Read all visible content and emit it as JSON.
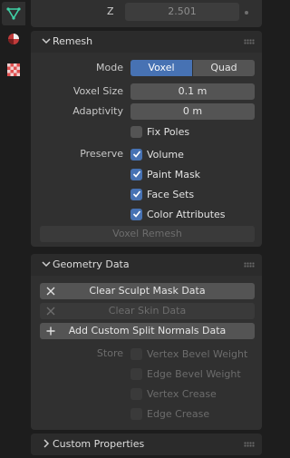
{
  "z_row": {
    "label": "Z",
    "value": "2.501"
  },
  "remesh": {
    "title": "Remesh",
    "mode_label": "Mode",
    "mode_options": [
      "Voxel",
      "Quad"
    ],
    "mode_selected": "Voxel",
    "voxel_size_label": "Voxel Size",
    "voxel_size_value": "0.1 m",
    "adaptivity_label": "Adaptivity",
    "adaptivity_value": "0 m",
    "fix_poles_label": "Fix Poles",
    "fix_poles_checked": false,
    "preserve_label": "Preserve",
    "preserve": [
      {
        "label": "Volume",
        "checked": true
      },
      {
        "label": "Paint Mask",
        "checked": true
      },
      {
        "label": "Face Sets",
        "checked": true
      },
      {
        "label": "Color Attributes",
        "checked": true
      }
    ],
    "remesh_button": "Voxel Remesh"
  },
  "geometry_data": {
    "title": "Geometry Data",
    "buttons": [
      {
        "label": "Clear Sculpt Mask Data",
        "icon": "x-icon",
        "enabled": true
      },
      {
        "label": "Clear Skin Data",
        "icon": "x-icon",
        "enabled": false
      },
      {
        "label": "Add Custom Split Normals Data",
        "icon": "plus-icon",
        "enabled": true
      }
    ],
    "store_label": "Store",
    "store_options": [
      {
        "label": "Vertex Bevel Weight",
        "checked": false
      },
      {
        "label": "Edge Bevel Weight",
        "checked": false
      },
      {
        "label": "Vertex Crease",
        "checked": false
      },
      {
        "label": "Edge Crease",
        "checked": false
      }
    ]
  },
  "custom_properties": {
    "title": "Custom Properties"
  },
  "colors": {
    "accent": "#4772b3",
    "panel": "#303030",
    "field": "#545454",
    "background": "#1d1d1d"
  }
}
